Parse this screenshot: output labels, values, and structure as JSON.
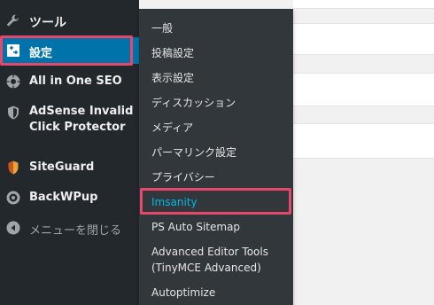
{
  "sidebar": {
    "items": [
      {
        "label": "ツール",
        "icon": "wrench-icon"
      },
      {
        "label": "設定",
        "icon": "settings-icon"
      },
      {
        "label": "All in One SEO",
        "icon": "seo-gear-icon"
      },
      {
        "label": "AdSense Invalid",
        "label2": "Click Protector",
        "icon": "shield-icon"
      },
      {
        "label": "SiteGuard",
        "icon": "siteguard-shield-icon"
      },
      {
        "label": "BackWPup",
        "icon": "backwpup-icon"
      },
      {
        "label": "メニューを閉じる",
        "icon": "collapse-arrow-icon"
      }
    ]
  },
  "submenu": {
    "items": [
      {
        "label": "一般"
      },
      {
        "label": "投稿設定"
      },
      {
        "label": "表示設定"
      },
      {
        "label": "ディスカッション"
      },
      {
        "label": "メディア"
      },
      {
        "label": "パーマリンク設定"
      },
      {
        "label": "プライバシー"
      },
      {
        "label": "Imsanity"
      },
      {
        "label": "PS Auto Sitemap"
      },
      {
        "label": "Advanced Editor Tools",
        "label2": "(TinyMCE Advanced)"
      },
      {
        "label": "Autoptimize"
      }
    ]
  },
  "colors": {
    "sidebar_bg": "#23282d",
    "submenu_bg": "#32373c",
    "current_bg": "#0073aa",
    "active_text": "#00b9eb",
    "highlight": "#e6486b"
  }
}
